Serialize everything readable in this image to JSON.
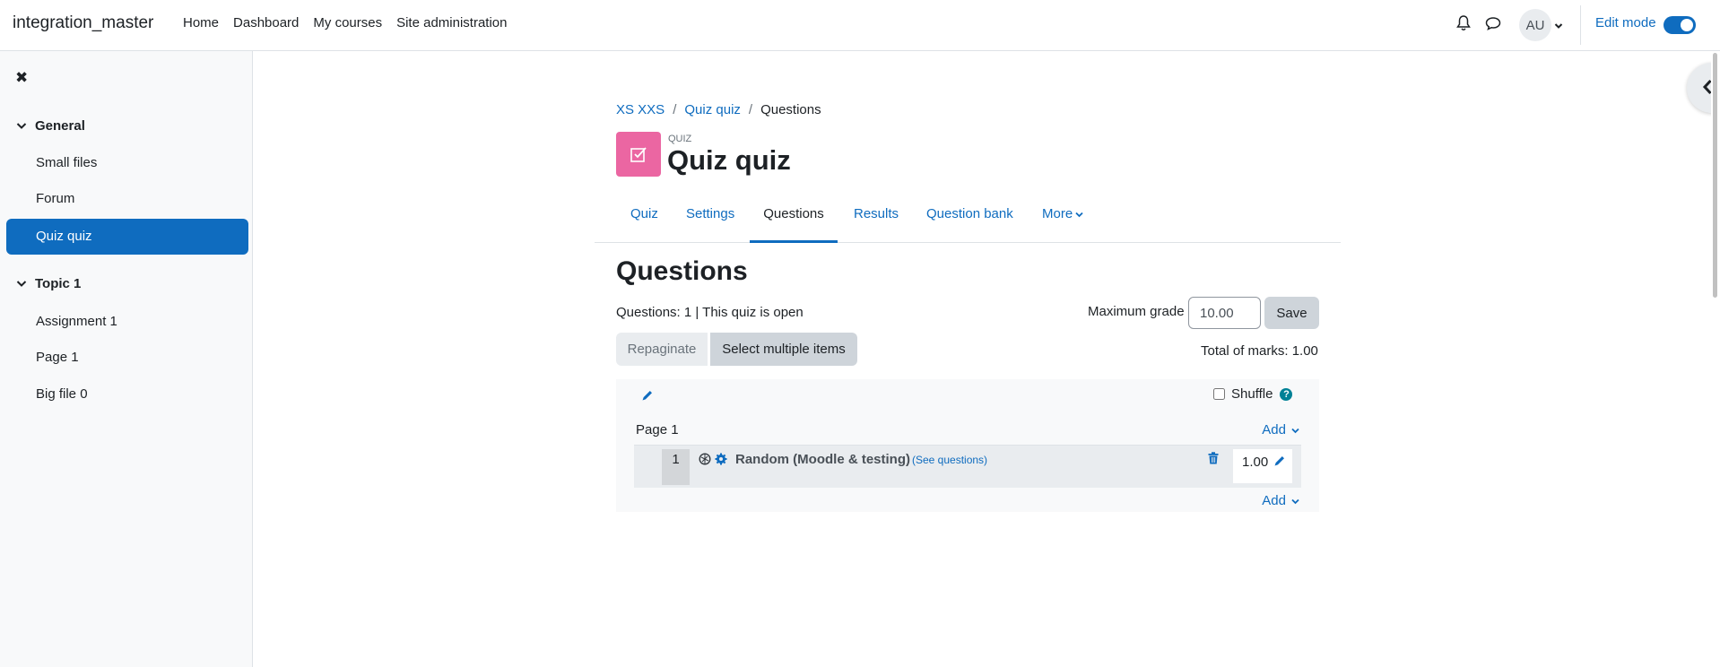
{
  "navbar": {
    "brand": "integration_master",
    "links": [
      "Home",
      "Dashboard",
      "My courses",
      "Site administration"
    ],
    "avatar_initials": "AU",
    "edit_mode_label": "Edit mode",
    "edit_mode_on": true
  },
  "drawer": {
    "sections": [
      {
        "title": "General",
        "items": [
          "Small files",
          "Forum",
          "Quiz quiz"
        ]
      },
      {
        "title": "Topic 1",
        "items": [
          "Assignment 1",
          "Page 1",
          "Big file 0"
        ]
      }
    ],
    "active_item": "Quiz quiz"
  },
  "breadcrumb": {
    "items": [
      "XS XXS",
      "Quiz quiz"
    ],
    "current": "Questions"
  },
  "header": {
    "kind": "QUIZ",
    "title": "Quiz quiz"
  },
  "tabs": [
    {
      "label": "Quiz",
      "active": false
    },
    {
      "label": "Settings",
      "active": false
    },
    {
      "label": "Questions",
      "active": true
    },
    {
      "label": "Results",
      "active": false
    },
    {
      "label": "Question bank",
      "active": false
    },
    {
      "label": "More",
      "active": false
    }
  ],
  "questions_page": {
    "heading": "Questions",
    "status": "Questions: 1 | This quiz is open",
    "max_grade_label": "Maximum grade",
    "max_grade_value": "10.00",
    "save_label": "Save",
    "repaginate_label": "Repaginate",
    "select_multiple_label": "Select multiple items",
    "total_marks": "Total of marks: 1.00",
    "shuffle_label": "Shuffle",
    "shuffle_checked": false,
    "page_label": "Page 1",
    "add_label": "Add",
    "question": {
      "number": "1",
      "title": "Random (Moodle & testing)",
      "see_link": "(See questions)",
      "mark": "1.00"
    }
  },
  "colors": {
    "primary": "#0f6cbf",
    "quiz_icon_bg": "#eb66a2",
    "help_icon": "#008196"
  }
}
